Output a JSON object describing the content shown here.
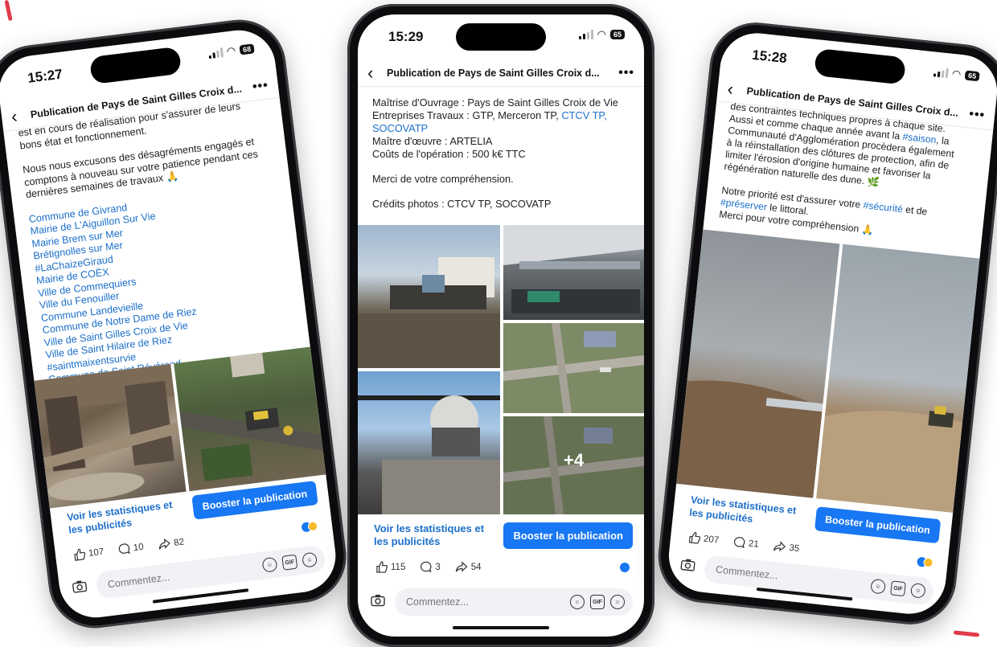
{
  "phones": {
    "left": {
      "time": "15:27",
      "battery": "68",
      "title": "Publication de Pays de Saint Gilles Croix d...",
      "text": {
        "l1": "est en cours de réalisation pour s'assurer de leurs",
        "l2": "bons état et fonctionnement.",
        "l3": "Nous nous excusons des désagréments engagés et",
        "l4": "comptons à nouveau sur votre patience pendant ces",
        "l5": "dernières semaines de travaux 🙏"
      },
      "tags": [
        "Commune de Givrand",
        "Mairie de L'Aiguillon Sur Vie",
        "Mairie Brem sur Mer",
        "Brétignolles sur Mer",
        "#LaChaizeGiraud",
        "Mairie de COËX",
        "Ville de Commequiers",
        "Ville du Fenouiller",
        "Commune Landevieille",
        "Commune de Notre Dame de Riez",
        "Ville de Saint Gilles Croix de Vie",
        "Ville de Saint Hilaire de Riez",
        "#saintmaixentsurvie",
        "Commune de Saint Révérend"
      ],
      "stats_link": "Voir les statistiques et les publicités",
      "boost": "Booster la publication",
      "likes": "107",
      "comments": "10",
      "shares": "82",
      "comment_placeholder": "Commentez..."
    },
    "middle": {
      "time": "15:29",
      "battery": "65",
      "title": "Publication de Pays de Saint Gilles Croix d...",
      "text": {
        "l1": "Maîtrise d'Ouvrage : Pays de Saint Gilles Croix de Vie",
        "l2": "Entreprises Travaux : GTP, Merceron TP,",
        "l2_link": "CTCV TP,",
        "l3_link": "SOCOVATP",
        "l4": "Maître d'œuvre : ARTELIA",
        "l5": "Coûts de l'opération : 500 k€ TTC",
        "l6": "Merci de votre compréhension.",
        "l7": "Crédits photos : CTCV TP, SOCOVATP"
      },
      "more_photos": "+4",
      "stats_link": "Voir les statistiques et les publicités",
      "boost": "Booster la publication",
      "likes": "115",
      "comments": "3",
      "shares": "54",
      "comment_placeholder": "Commentez..."
    },
    "right": {
      "time": "15:28",
      "battery": "65",
      "title": "Publication de Pays de Saint Gilles Croix d...",
      "text": {
        "l1": "des contraintes techniques propres à chaque site.",
        "l2a": "Aussi et comme chaque année avant la",
        "l2_link": "#saison",
        "l2b": ", la",
        "l3": "Communauté d'Agglomération procèdera également",
        "l4": "à la réinstallation des clôtures de protection, afin de",
        "l5": "limiter l'érosion d'origine humaine et favoriser la",
        "l6": "régénération naturelle des dune. 🌿",
        "l7a": "Notre priorité est d'assurer votre",
        "l7_link": "#sécurité",
        "l7b": "et de",
        "l8_link": "#préserver",
        "l8b": "le littoral.",
        "l9": "Merci pour votre compréhension 🙏"
      },
      "stats_link": "Voir les statistiques et les publicités",
      "boost": "Booster la publication",
      "likes": "207",
      "comments": "21",
      "shares": "35",
      "comment_placeholder": "Commentez..."
    }
  },
  "colors": {
    "link": "#1b6fc9",
    "boost_button": "#1877f2",
    "accent_mark": "#e23b4b"
  }
}
